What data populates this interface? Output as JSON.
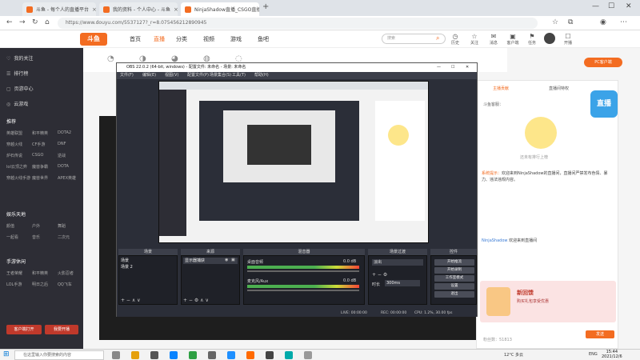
{
  "browser": {
    "tabs": [
      {
        "label": "斗鱼 - 每个人的直播平台"
      },
      {
        "label": "我的资料 - 个人中心 - 斗鱼"
      },
      {
        "label": "NinjaShadow直播_CSGO直播_..."
      }
    ],
    "new_tab": "+",
    "url": "https://www.douyu.com/5537127?_r=8.075456212890945"
  },
  "site": {
    "logo": "斗鱼",
    "nav": [
      "首页",
      "直播",
      "分类",
      "视频",
      "游戏",
      "鱼吧"
    ],
    "search_placeholder": "搜索",
    "header_icons": [
      {
        "icon": "◷",
        "label": "历史"
      },
      {
        "icon": "☆",
        "label": "关注"
      },
      {
        "icon": "✉",
        "label": "消息"
      },
      {
        "icon": "▣",
        "label": "客户端"
      },
      {
        "icon": "⚑",
        "label": "任务"
      },
      {
        "icon": "☐",
        "label": "开播"
      }
    ],
    "pc_client": "PC客户端"
  },
  "sidebar": {
    "items": [
      {
        "icon": "♡",
        "label": "我的关注"
      },
      {
        "icon": "☰",
        "label": "排行榜"
      },
      {
        "icon": "▢",
        "label": "页游中心"
      },
      {
        "icon": "◎",
        "label": "云游戏"
      }
    ],
    "recommend_head": "推荐",
    "group1": [
      "英雄联盟",
      "和平精英",
      "DOTA2",
      "穿越火线",
      "CF手游",
      "DNF",
      "炉石传说",
      "CSGO",
      "逆战",
      "lol云顶之弈",
      "魔兽争霸",
      "DOTA",
      "穿越火线手游",
      "魔兽世界",
      "APEX英雄"
    ],
    "section2_head": "娱乐天地",
    "group2": [
      "颜值",
      "户外",
      "舞蹈",
      "一起看",
      "音乐",
      "二次元"
    ],
    "section3_head": "手游休闲",
    "group3": [
      "王者荣耀",
      "和平精英",
      "火影忍者",
      "LOL手游",
      "明日之后",
      "QQ飞车"
    ],
    "buttons": [
      "客户端打开",
      "我要开播"
    ]
  },
  "obs": {
    "title": "OBS 22.0.2 (64-bit, windows) - 配置文件: 未命名 - 场景: 未命名",
    "menu": [
      "文件(F)",
      "编辑(E)",
      "视图(V)",
      "配置文件(P)",
      "场景集合(S)",
      "工具(T)",
      "帮助(H)"
    ],
    "docks": [
      "场景",
      "来源",
      "混音器",
      "场景过渡",
      "控件"
    ],
    "scenes": [
      "场景",
      "场景 2"
    ],
    "sources": [
      "显示器捕获"
    ],
    "mixer": [
      {
        "name": "桌面音频",
        "db": "0.0 dB"
      },
      {
        "name": "麦克风/Aux",
        "db": "0.0 dB"
      }
    ],
    "transition": "淡出",
    "duration_label": "时长",
    "duration": "300ms",
    "controls": [
      "开始推流",
      "开始录制",
      "工作室模式",
      "设置",
      "退出"
    ],
    "status": {
      "live": "LIVE: 00:00:00",
      "rec": "REC: 00:00:00",
      "cpu": "CPU: 1.2%, 30.00 fps"
    }
  },
  "right_panel": {
    "tabs": [
      "主播贡献",
      "直播间特权"
    ],
    "announcement": "斗鱼客服：",
    "mascot_caption": "还未有排行上榜",
    "chat": [
      {
        "user": "系统提示：",
        "text": "欢迎来到NinjaShadow的直播间，直播间严禁发布色情、暴力、违法违规内容。"
      },
      {
        "user": "NinjaShadow",
        "text": "欢迎来到直播间"
      }
    ],
    "promo_title": "新回馈",
    "promo_sub": "购买礼包享受优惠",
    "promo_button": "立即购买",
    "send_button": "发送",
    "fans": "粉丝数：51813"
  },
  "taskbar": {
    "search": "在这里输入你要搜索的内容",
    "weather": "12°C 多云",
    "lang": "ENG",
    "time": "15:44",
    "date": "2021/12/6"
  }
}
